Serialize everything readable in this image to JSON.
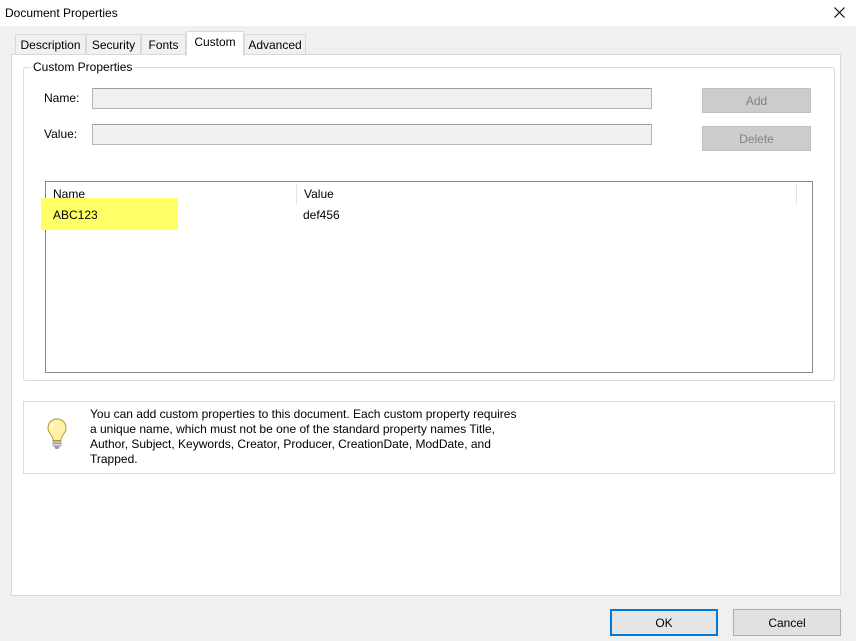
{
  "window": {
    "title": "Document Properties"
  },
  "tabs": [
    {
      "label": "Description"
    },
    {
      "label": "Security"
    },
    {
      "label": "Fonts"
    },
    {
      "label": "Custom"
    },
    {
      "label": "Advanced"
    }
  ],
  "custom": {
    "group_label": "Custom Properties",
    "name_label": "Name:",
    "value_label": "Value:",
    "name_value": "",
    "value_value": "",
    "add_label": "Add",
    "delete_label": "Delete",
    "columns": [
      "Name",
      "Value"
    ],
    "rows": [
      {
        "name": "ABC123",
        "value": "def456"
      }
    ]
  },
  "info": {
    "icon": "lightbulb-icon",
    "line1": "You can add custom properties to this document. Each custom property requires",
    "line2": "a unique name, which must not be one of the standard property names Title,",
    "line3": "Author, Subject, Keywords, Creator, Producer, CreationDate, ModDate, and",
    "line4": "Trapped."
  },
  "buttons": {
    "ok": "OK",
    "cancel": "Cancel"
  },
  "colors": {
    "highlight": "#ffff66",
    "focus": "#0078d7"
  }
}
